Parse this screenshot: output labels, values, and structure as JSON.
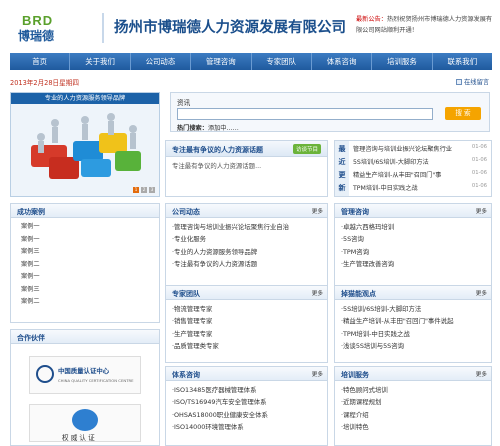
{
  "header": {
    "logo_en": "BRD",
    "logo_cn": "博瑞德",
    "company_name": "扬州市博瑞德人力资源发展有限公司",
    "notice_label": "最新公告：",
    "notice_text": "热烈祝贺扬州市博瑞德人力资源发展有限公司网站顺利开通！"
  },
  "nav": [
    "首页",
    "关于我们",
    "公司动态",
    "管理咨询",
    "专家团队",
    "体系咨询",
    "培训服务",
    "联系我们"
  ],
  "date": "2013年2月28日星期四",
  "favorite_label": "在线留言",
  "banner": {
    "title": "专业的人力资源服务领导品牌",
    "dots": [
      "1",
      "2",
      "3"
    ]
  },
  "search": {
    "label": "资讯",
    "button": "搜 索",
    "hot_label": "热门搜索：",
    "hot_value": "添加中……"
  },
  "topic": {
    "title": "专注最有争议的人力资源话题",
    "tag": "访谈节目",
    "body": "专注最有争议的人力资源话题..."
  },
  "latest": {
    "side": [
      "最",
      "近",
      "更",
      "新"
    ],
    "items": [
      {
        "text": "管理咨询与培训业振兴论坛聚焦行业",
        "date": "01-06"
      },
      {
        "text": "5S培训/6S培训-大脚印方法",
        "date": "01-06"
      },
      {
        "text": "精益生产培训-从丰田\"召回门\"事",
        "date": "01-06"
      },
      {
        "text": "TPM培训-中日实践之战",
        "date": "01-06"
      }
    ]
  },
  "cases": {
    "title": "成功案例",
    "items": [
      "案例一",
      "案例一",
      "案例三",
      "案例二",
      "案例一",
      "案例三",
      "案例二"
    ]
  },
  "partners": {
    "title": "合作伙伴",
    "cert1": "中国质量认证中心",
    "cert1_sub": "CHINA QUALITY CERTIFICATION CENTRE",
    "cert2": "权 威 认 证"
  },
  "panels": {
    "news": {
      "title": "公司动态",
      "more": "更多",
      "items": [
        "管理咨询与培训业振兴论坛聚焦行业自治",
        "专业化服务",
        "专业的人力资源服务领导品牌",
        "专注最有争议的人力资源话题"
      ]
    },
    "consult": {
      "title": "管理咨询",
      "more": "更多",
      "items": [
        "卓越六西格玛培训",
        "5S咨询",
        "TPM咨询",
        "生产管理改善咨询"
      ]
    },
    "experts": {
      "title": "专家团队",
      "more": "更多",
      "items": [
        "物流管理专家",
        "销售管理专家",
        "生产管理专家",
        "品质管理类专家"
      ]
    },
    "hot": {
      "title": "掉猫能观点",
      "more": "更多",
      "items": [
        "5S培训/6S培训-大脚印方法",
        "精益生产培训-从丰田\"召回门\"事件说起",
        "TPM培训-中日实践之战",
        "浅谈5S培训与5S咨询"
      ]
    },
    "system": {
      "title": "体系咨询",
      "more": "更多",
      "items": [
        "ISO13485医疗器械管理体系",
        "ISO/TS16949汽车安全管理体系",
        "OHSAS18000职业健康安全体系",
        "ISO14000环境管理体系"
      ]
    },
    "training": {
      "title": "培训服务",
      "more": "更多",
      "items": [
        "特色顾问式培训",
        "近期课程规划",
        "课程介绍",
        "培训特色"
      ]
    }
  }
}
